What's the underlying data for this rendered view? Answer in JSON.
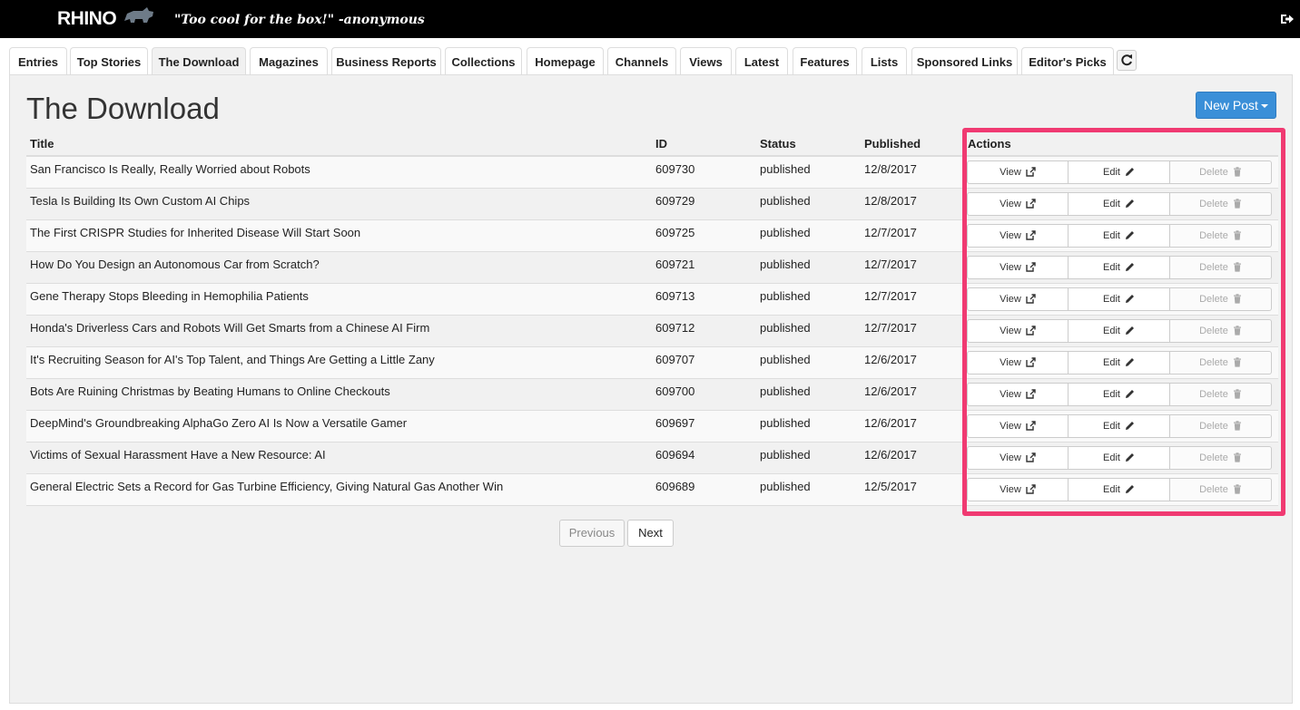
{
  "header": {
    "logo_text": "RHINO",
    "tagline": "\"Too cool for the box!\" -anonymous"
  },
  "tabs": [
    {
      "label": "Entries",
      "active": false
    },
    {
      "label": "Top Stories",
      "active": false
    },
    {
      "label": "The Download",
      "active": true
    },
    {
      "label": "Magazines",
      "active": false
    },
    {
      "label": "Business Reports",
      "active": false
    },
    {
      "label": "Collections",
      "active": false
    },
    {
      "label": "Homepage",
      "active": false
    },
    {
      "label": "Channels",
      "active": false
    },
    {
      "label": "Views",
      "active": false
    },
    {
      "label": "Latest",
      "active": false
    },
    {
      "label": "Features",
      "active": false
    },
    {
      "label": "Lists",
      "active": false
    },
    {
      "label": "Sponsored Links",
      "active": false
    },
    {
      "label": "Editor's Picks",
      "active": false
    }
  ],
  "page": {
    "title": "The Download",
    "new_post_label": "New Post"
  },
  "table": {
    "columns": {
      "title": "Title",
      "id": "ID",
      "status": "Status",
      "published": "Published",
      "actions": "Actions"
    },
    "action_labels": {
      "view": "View",
      "edit": "Edit",
      "delete": "Delete"
    },
    "rows": [
      {
        "title": "San Francisco Is Really, Really Worried about Robots",
        "id": "609730",
        "status": "published",
        "published": "12/8/2017"
      },
      {
        "title": "Tesla Is Building Its Own Custom AI Chips",
        "id": "609729",
        "status": "published",
        "published": "12/8/2017"
      },
      {
        "title": "The First CRISPR Studies for Inherited Disease Will Start Soon",
        "id": "609725",
        "status": "published",
        "published": "12/7/2017"
      },
      {
        "title": "How Do You Design an Autonomous Car from Scratch?",
        "id": "609721",
        "status": "published",
        "published": "12/7/2017"
      },
      {
        "title": "Gene Therapy Stops Bleeding in Hemophilia Patients",
        "id": "609713",
        "status": "published",
        "published": "12/7/2017"
      },
      {
        "title": "Honda's Driverless Cars and Robots Will Get Smarts from a Chinese AI Firm",
        "id": "609712",
        "status": "published",
        "published": "12/7/2017"
      },
      {
        "title": "It's Recruiting Season for AI's Top Talent, and Things Are Getting a Little Zany",
        "id": "609707",
        "status": "published",
        "published": "12/6/2017"
      },
      {
        "title": "Bots Are Ruining Christmas by Beating Humans to Online Checkouts",
        "id": "609700",
        "status": "published",
        "published": "12/6/2017"
      },
      {
        "title": "DeepMind's Groundbreaking AlphaGo Zero AI Is Now a Versatile Gamer",
        "id": "609697",
        "status": "published",
        "published": "12/6/2017"
      },
      {
        "title": "Victims of Sexual Harassment Have a New Resource: AI",
        "id": "609694",
        "status": "published",
        "published": "12/6/2017"
      },
      {
        "title": "General Electric Sets a Record for Gas Turbine Efficiency, Giving Natural Gas Another Win",
        "id": "609689",
        "status": "published",
        "published": "12/5/2017"
      }
    ]
  },
  "pagination": {
    "previous_label": "Previous",
    "next_label": "Next"
  },
  "colors": {
    "accent": "#3a8fd8",
    "highlight": "#f03a72"
  }
}
